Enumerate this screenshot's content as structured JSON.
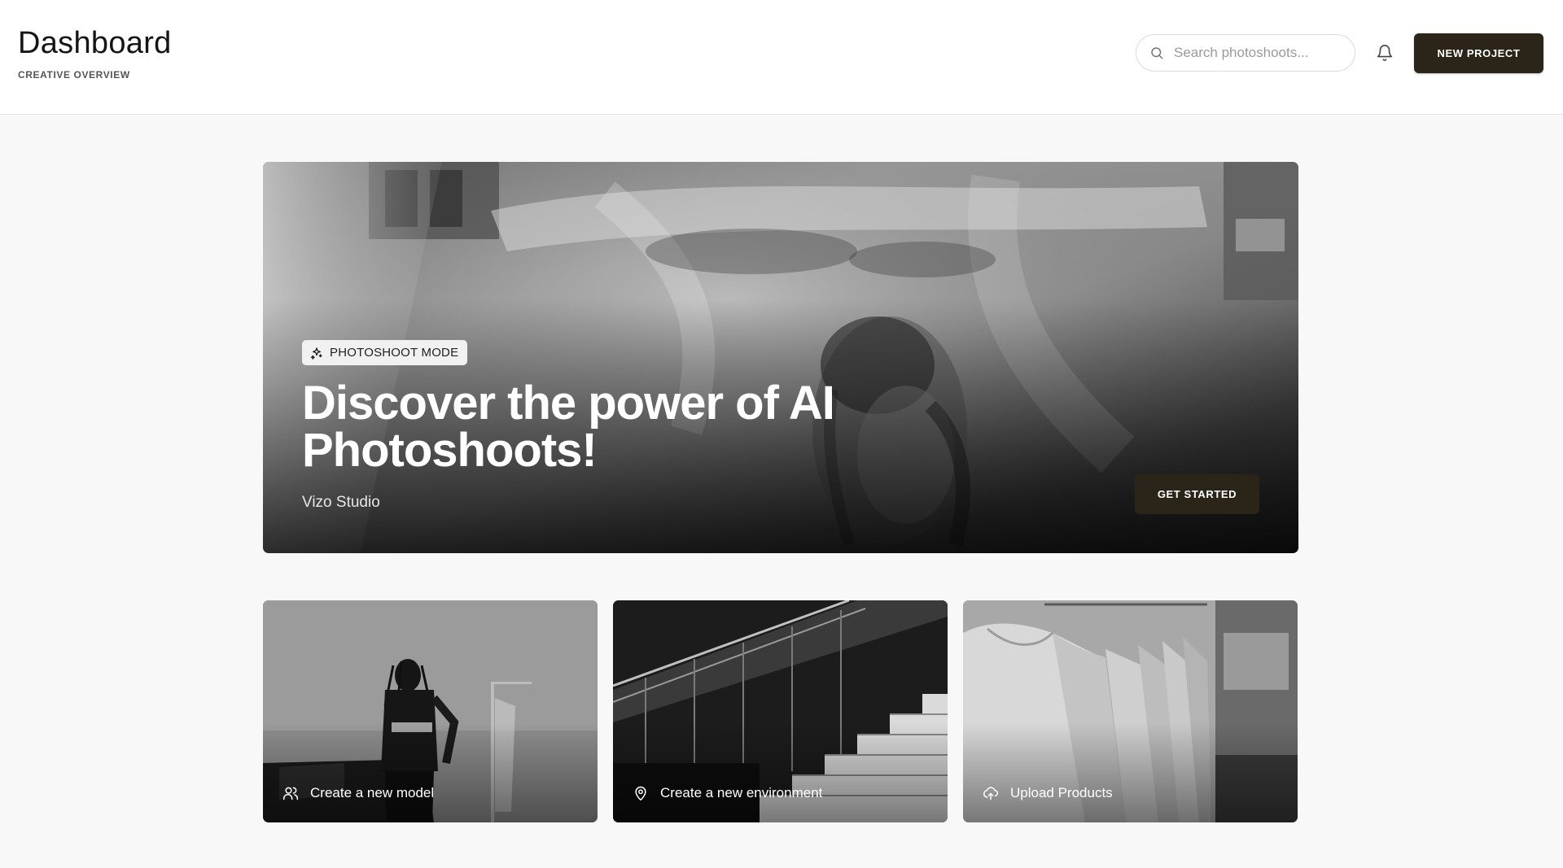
{
  "header": {
    "title": "Dashboard",
    "subtitle": "CREATIVE OVERVIEW",
    "search_placeholder": "Search photoshoots...",
    "search_icon": "search-icon",
    "bell_icon": "bell-icon",
    "new_project_label": "NEW PROJECT"
  },
  "hero": {
    "badge_icon": "sparkles-icon",
    "badge_label": "PHOTOSHOOT MODE",
    "title": "Discover the power of AI Photoshoots!",
    "brand": "Vizo Studio",
    "cta_label": "GET STARTED"
  },
  "cards": [
    {
      "icon": "users-icon",
      "label": "Create a new model"
    },
    {
      "icon": "map-pin-icon",
      "label": "Create a new environment"
    },
    {
      "icon": "cloud-upload-icon",
      "label": "Upload Products"
    }
  ],
  "colors": {
    "button_bg": "#2b2519",
    "page_bg": "#f8f8f8",
    "header_bg": "#ffffff"
  }
}
